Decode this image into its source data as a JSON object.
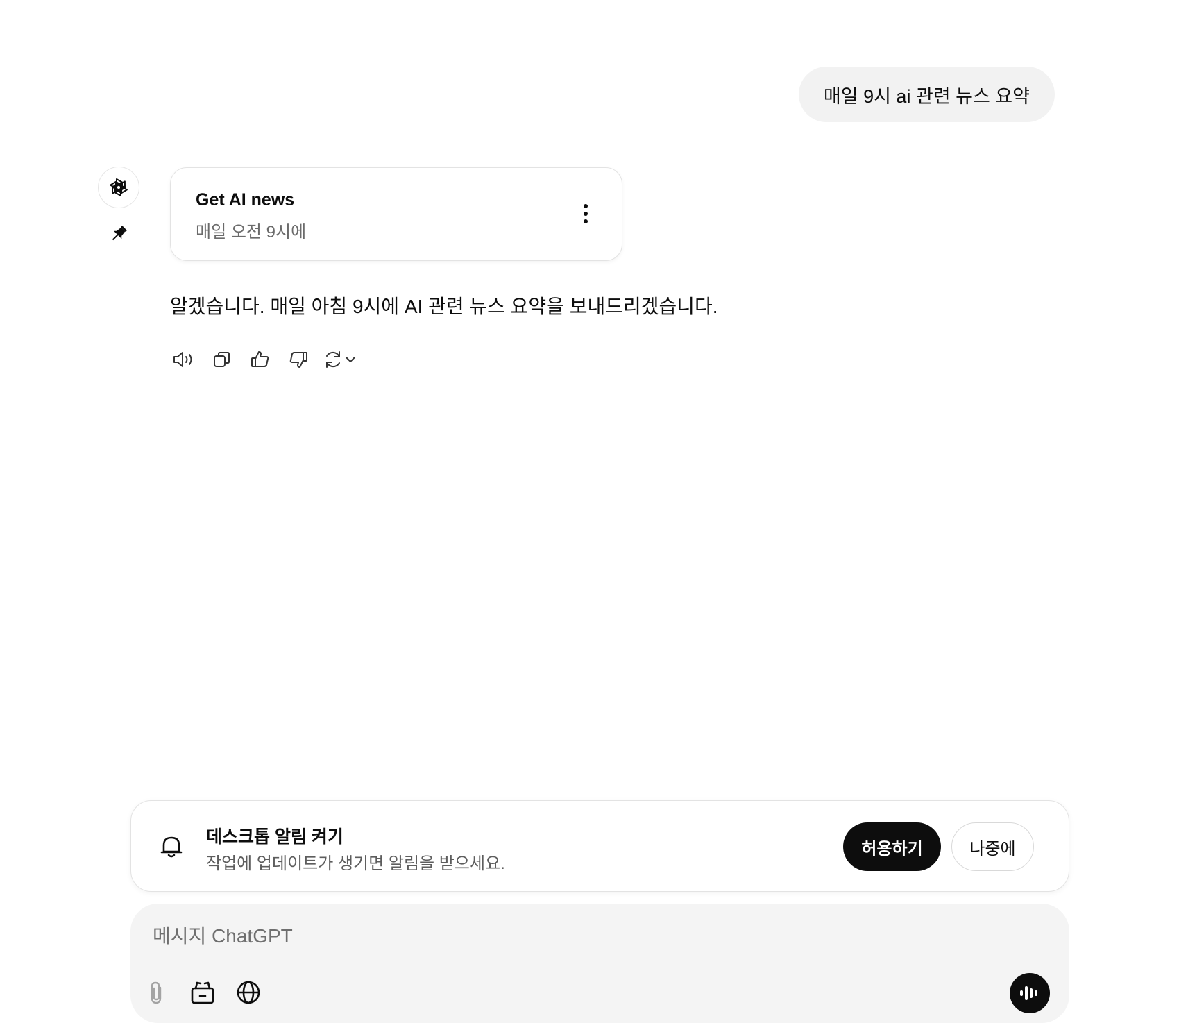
{
  "conversation": {
    "user_message": "매일 9시 ai 관련 뉴스 요약",
    "assistant": {
      "avatar_icon": "openai-logo-icon",
      "pin_icon": "pin-icon",
      "task_card": {
        "title": "Get AI news",
        "schedule": "매일 오전 9시에",
        "menu_icon": "more-vertical-icon"
      },
      "reply": "알겠습니다. 매일 아침 9시에 AI 관련 뉴스 요약을 보내드리겠습니다.",
      "actions": [
        "read-aloud-icon",
        "copy-icon",
        "thumbs-up-icon",
        "thumbs-down-icon",
        "regenerate-icon"
      ]
    }
  },
  "notification": {
    "title": "데스크톱 알림 켜기",
    "description": "작업에 업데이트가 생기면 알림을 받으세요.",
    "allow_label": "허용하기",
    "later_label": "나중에"
  },
  "composer": {
    "placeholder": "메시지 ChatGPT",
    "value": "",
    "tools": [
      "attach-icon",
      "tools-icon",
      "globe-icon"
    ],
    "voice_icon": "voice-mode-icon"
  },
  "colors": {
    "user_bubble_bg": "#f2f2f2",
    "primary_button": "#0d0d0d",
    "composer_bg": "#f4f4f4"
  }
}
